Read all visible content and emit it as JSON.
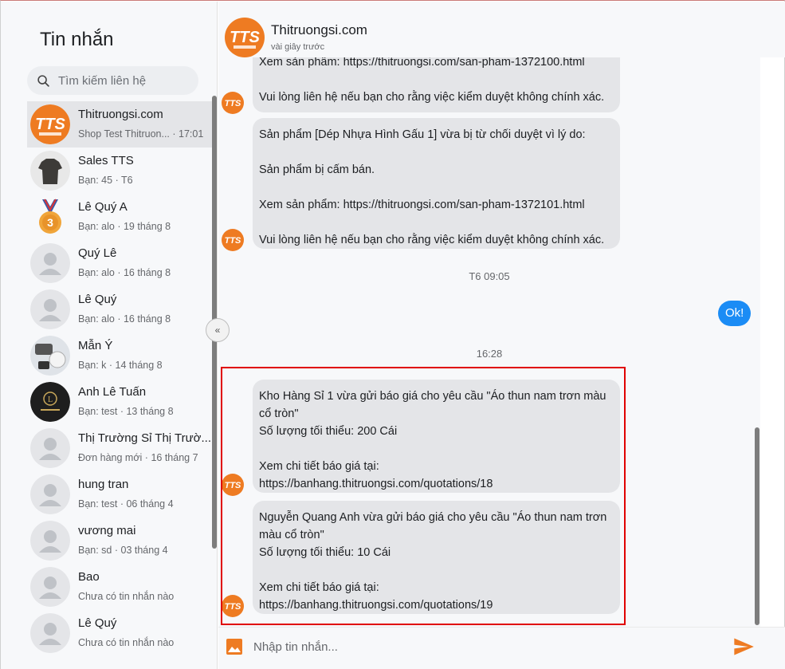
{
  "sidebar": {
    "title": "Tin nhắn",
    "search_placeholder": "Tìm kiếm liên hệ",
    "contacts": [
      {
        "name": "Thitruongsi.com",
        "preview": "Shop Test Thitruon...",
        "time": "17:01",
        "avatar": "tts-logo"
      },
      {
        "name": "Sales TTS",
        "preview": "Bạn: 45",
        "time": "T6",
        "avatar": "tshirt-photo"
      },
      {
        "name": "Lê Quý A",
        "preview": "Bạn: alo",
        "time": "19 tháng 8",
        "avatar": "medal-icon"
      },
      {
        "name": "Quý Lê",
        "preview": "Bạn: alo",
        "time": "16 tháng 8",
        "avatar": "default-user"
      },
      {
        "name": "Lê Quý",
        "preview": "Bạn: alo",
        "time": "16 tháng 8",
        "avatar": "default-user"
      },
      {
        "name": "Mẫn Ý",
        "preview": "Bạn: k",
        "time": "14 tháng 8",
        "avatar": "photo"
      },
      {
        "name": "Anh Lê Tuấn",
        "preview": "Bạn: test",
        "time": "13 tháng 8",
        "avatar": "luxury-logo"
      },
      {
        "name": "Thị Trường Sỉ Thị Trườ...",
        "preview": "Đơn hàng mới",
        "time": "16 tháng 7",
        "avatar": "default-user"
      },
      {
        "name": "hung tran",
        "preview": "Bạn: test",
        "time": "06 tháng 4",
        "avatar": "default-user"
      },
      {
        "name": "vương mai",
        "preview": "Bạn: sd",
        "time": "03 tháng 4",
        "avatar": "default-user"
      },
      {
        "name": "Bao",
        "preview": "Chưa có tin nhắn nào",
        "time": "",
        "avatar": "default-user"
      },
      {
        "name": "Lê Quý",
        "preview": "Chưa có tin nhắn nào",
        "time": "",
        "avatar": "default-user"
      }
    ],
    "collapse_label": "«"
  },
  "chat": {
    "name": "Thitruongsi.com",
    "status": "vài giây trước",
    "messages": [
      "Xem sản phẩm: https://thitruongsi.com/san-pham-1372100.html\n\nVui lòng liên hệ nếu bạn cho rằng việc kiểm duyệt không chính xác.",
      "Sản phẩm [Dép Nhựa Hình Gấu 1] vừa bị từ chối duyệt vì lý do:\n\nSản phẩm bị cấm bán.\n\nXem sản phẩm: https://thitruongsi.com/san-pham-1372101.html\n\nVui lòng liên hệ nếu bạn cho rằng việc kiểm duyệt không chính xác.",
      "Kho Hàng Sỉ 1 vừa gửi báo giá cho yêu cầu \"Áo thun nam trơn màu cổ tròn\"\nSố lượng tối thiểu: 200 Cái\n\nXem chi tiết báo giá tại:\nhttps://banhang.thitruongsi.com/quotations/18",
      "Nguyễn Quang Anh vừa gửi báo giá cho yêu cầu \"Áo thun nam trơn màu cổ tròn\"\nSố lượng tối thiểu: 10 Cái\n\nXem chi tiết báo giá tại:\nhttps://banhang.thitruongsi.com/quotations/19"
    ],
    "time_1": "T6 09:05",
    "my_message": "Ok!",
    "time_2": "16:28",
    "input_placeholder": "Nhập tin nhắn..."
  },
  "colors": {
    "brand_orange": "#ee7b22",
    "my_bubble": "#1b8cf5",
    "highlight_border": "#e00000",
    "send_icon": "#ee7b22"
  }
}
